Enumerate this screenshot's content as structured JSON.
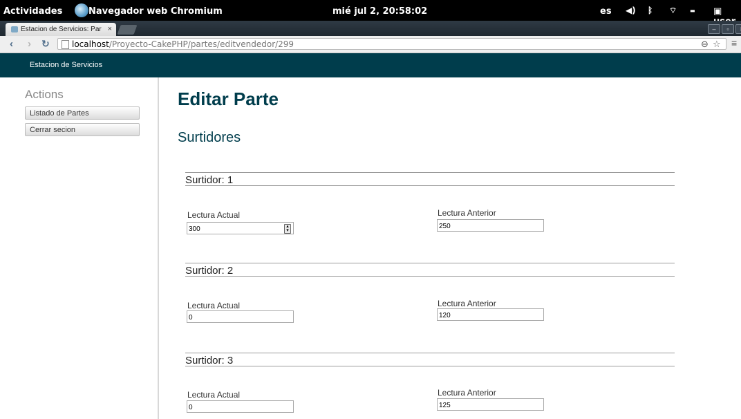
{
  "system": {
    "activities": "Actividades",
    "app_name": "Navegador web Chromium",
    "clock": "mié jul  2, 20:58:02",
    "lang": "es",
    "user": "user",
    "tray_icons": [
      "volume-icon",
      "bluetooth-icon",
      "wifi-icon",
      "battery-icon"
    ]
  },
  "browser": {
    "tab_title": "Estacion de Servicios: Par",
    "url_host": "localhost",
    "url_path": "/Proyecto-CakePHP/partes/editvendedor/299"
  },
  "site": {
    "header_title": "Estacion de Servicios"
  },
  "sidebar": {
    "heading": "Actions",
    "items": [
      {
        "label": "Listado de Partes"
      },
      {
        "label": "Cerrar secion"
      }
    ]
  },
  "main": {
    "title": "Editar Parte",
    "section": "Surtidores",
    "surtidores": [
      {
        "legend": "Surtidor: 1",
        "actual_label": "Lectura Actual",
        "actual_value": "300",
        "anterior_label": "Lectura Anterior",
        "anterior_value": "250"
      },
      {
        "legend": "Surtidor: 2",
        "actual_label": "Lectura Actual",
        "actual_value": "0",
        "anterior_label": "Lectura Anterior",
        "anterior_value": "120"
      },
      {
        "legend": "Surtidor: 3",
        "actual_label": "Lectura Actual",
        "actual_value": "0",
        "anterior_label": "Lectura Anterior",
        "anterior_value": "125"
      }
    ]
  }
}
